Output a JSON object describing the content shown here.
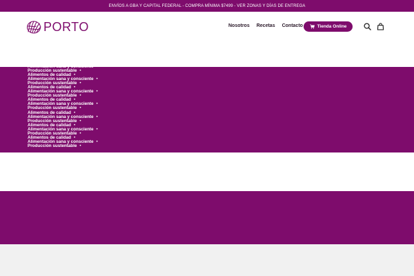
{
  "announcement": "ENVÍOS A GBA Y CAPITAL FEDERAL - COMPRA MÍNIMA $7499 - VER ZONAS Y DÍAS DE ENTREGA",
  "brand": {
    "name": "PORTO",
    "color": "#7e0c6c"
  },
  "nav": {
    "items": [
      {
        "label": "Nosotros"
      },
      {
        "label": "Recetas"
      },
      {
        "label": "Contacto"
      }
    ],
    "shop_button": "Tienda Online",
    "icons": [
      "shopping-cart-icon",
      "search-icon",
      "shopping-bag-icon"
    ]
  },
  "ticker": [
    "Alimentación sana y consciente",
    "Producción sustentable",
    "Alimentos de calidad",
    "Alimentación sana y consciente",
    "Producción sustentable",
    "Alimentos de calidad",
    "Alimentación sana y consciente",
    "Producción sustentable",
    "Alimentos de calidad",
    "Alimentación sana y consciente",
    "Producción sustentable",
    "Alimentos de calidad",
    "Alimentación sana y consciente",
    "Producción sustentable",
    "Alimentos de calidad",
    "Alimentación sana y consciente",
    "Producción sustentable",
    "Alimentos de calidad",
    "Alimentación sana y consciente",
    "Producción sustentable"
  ],
  "ticker_separator": "•",
  "colors": {
    "accent": "#7e0c6c",
    "footer_bg": "#f1f1f1",
    "text_dark": "#2b1a2a"
  }
}
